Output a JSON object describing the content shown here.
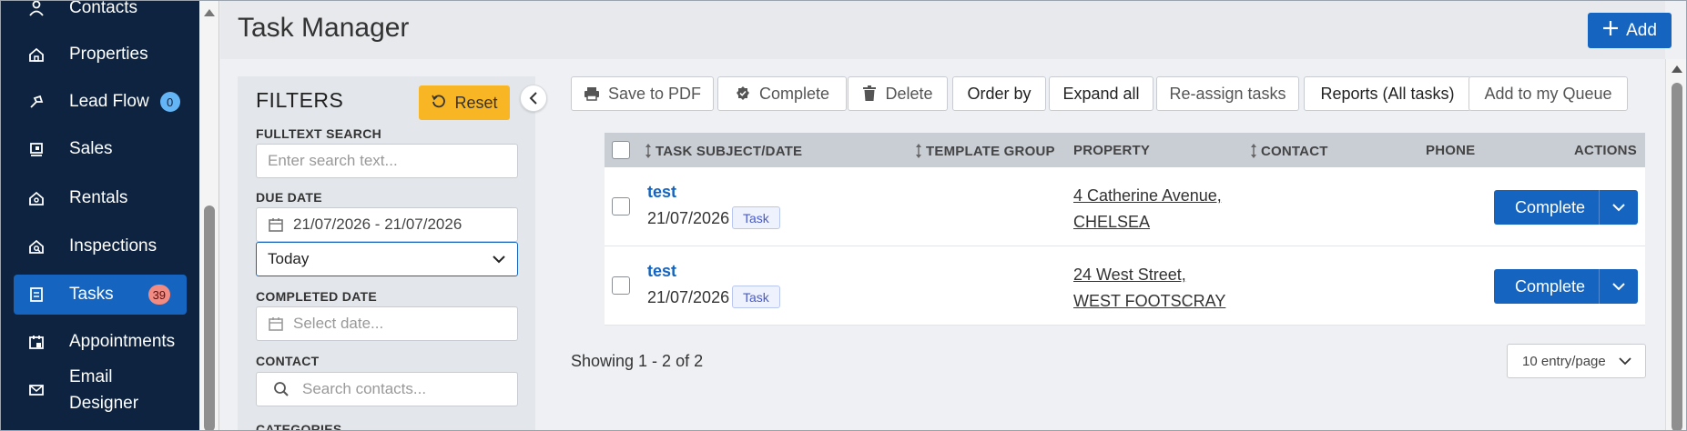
{
  "sidebar": {
    "items": [
      {
        "label": "Contacts",
        "icon": "contacts-icon"
      },
      {
        "label": "Properties",
        "icon": "home-icon"
      },
      {
        "label": "Lead Flow",
        "icon": "lead-flow-icon",
        "badge": "0"
      },
      {
        "label": "Sales",
        "icon": "sales-icon"
      },
      {
        "label": "Rentals",
        "icon": "rentals-icon"
      },
      {
        "label": "Inspections",
        "icon": "inspections-icon"
      },
      {
        "label": "Tasks",
        "icon": "tasks-icon",
        "badge": "39",
        "active": true
      },
      {
        "label": "Appointments",
        "icon": "calendar-icon"
      },
      {
        "label": "Email",
        "label2": "Designer",
        "icon": "email-icon"
      }
    ]
  },
  "header": {
    "title": "Task Manager",
    "add_label": "Add"
  },
  "filters": {
    "title": "FILTERS",
    "reset_label": "Reset",
    "fulltext_label": "FULLTEXT SEARCH",
    "fulltext_placeholder": "Enter search text...",
    "due_date_label": "DUE DATE",
    "due_date_value": "21/07/2026 - 21/07/2026",
    "due_date_preset": "Today",
    "completed_date_label": "COMPLETED DATE",
    "completed_date_placeholder": "Select date...",
    "contact_label": "CONTACT",
    "contact_placeholder": "Search contacts...",
    "categories_label": "CATEGORIES"
  },
  "toolbar": {
    "save_pdf": "Save to PDF",
    "complete": "Complete",
    "delete": "Delete",
    "order_by": "Order by",
    "expand_all": "Expand all",
    "reassign": "Re-assign tasks",
    "reports": "Reports (All tasks)",
    "add_queue": "Add to my Queue"
  },
  "table": {
    "columns": {
      "subject": "TASK SUBJECT/DATE",
      "template_group": "TEMPLATE GROUP",
      "property": "PROPERTY",
      "contact": "CONTACT",
      "phone": "PHONE",
      "actions": "ACTIONS"
    },
    "rows": [
      {
        "subject": "test",
        "date": "21/07/2026",
        "tag": "Task",
        "property_line1": "4 Catherine Avenue,",
        "property_line2": "CHELSEA",
        "action": "Complete"
      },
      {
        "subject": "test",
        "date": "21/07/2026",
        "tag": "Task",
        "property_line1": "24 West Street,",
        "property_line2": "WEST FOOTSCRAY",
        "action": "Complete"
      }
    ]
  },
  "footer": {
    "showing": "Showing 1 - 2 of 2",
    "per_page": "10 entry/page"
  },
  "colors": {
    "sidebar_bg": "#0d2340",
    "primary": "#1565c0",
    "reset": "#f8b624"
  }
}
